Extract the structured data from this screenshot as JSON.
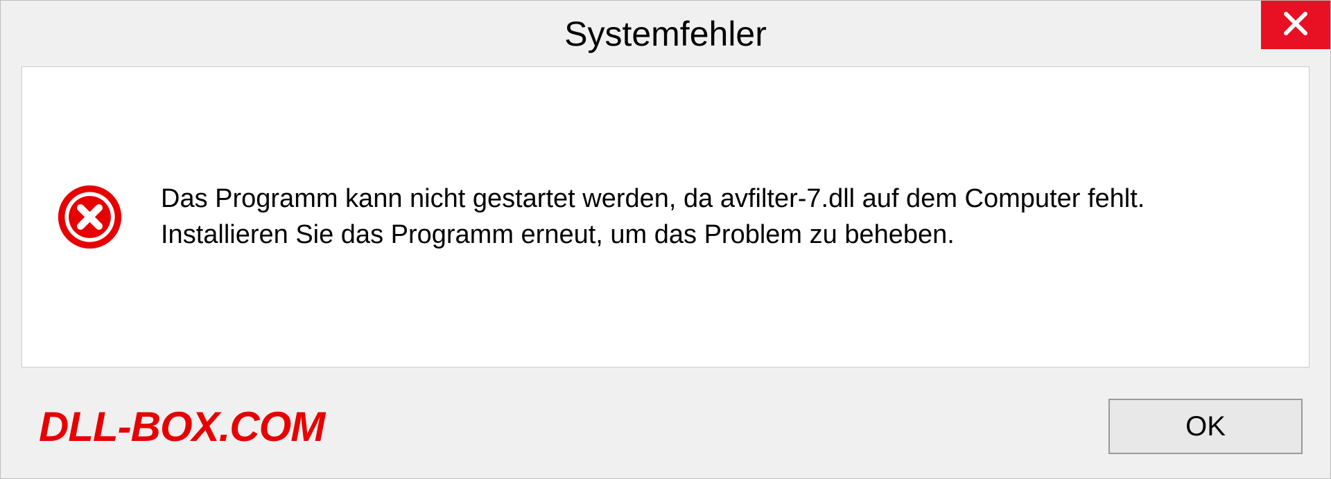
{
  "dialog": {
    "title": "Systemfehler",
    "message": "Das Programm kann nicht gestartet werden, da avfilter-7.dll auf dem Computer fehlt. Installieren Sie das Programm erneut, um das Problem zu beheben.",
    "ok_label": "OK"
  },
  "watermark": "DLL-BOX.COM"
}
